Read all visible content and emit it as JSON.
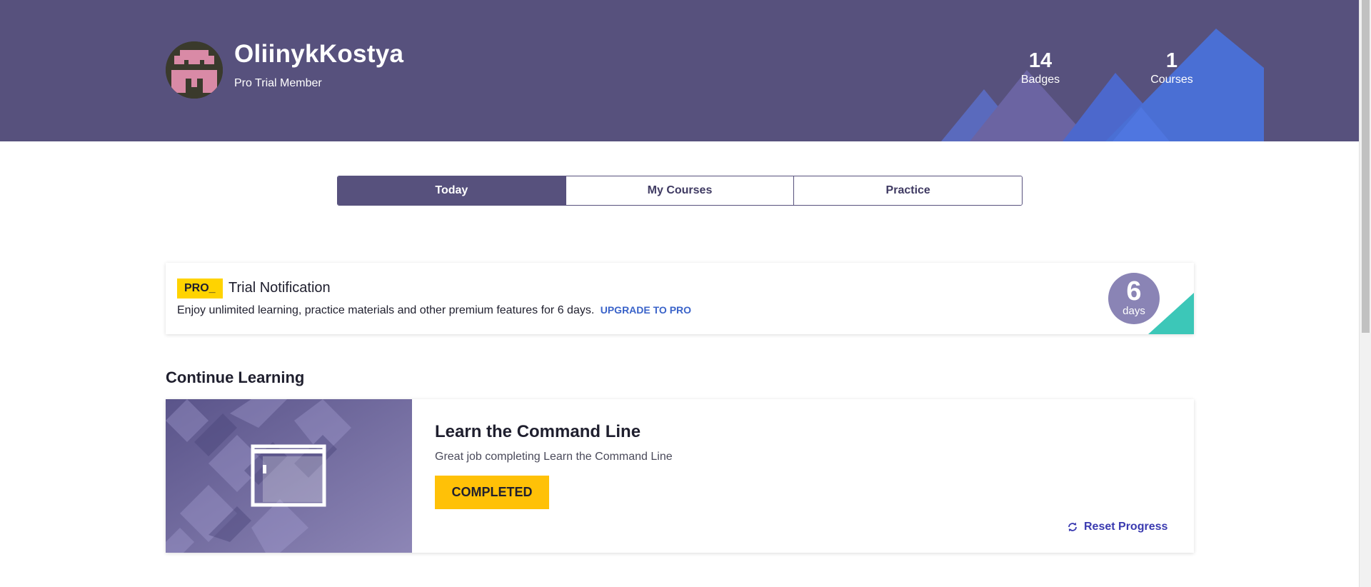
{
  "profile": {
    "username": "OliinykKostya",
    "membership": "Pro Trial Member",
    "avatar_icon": "pixel-avatar-icon"
  },
  "stats": [
    {
      "value": "14",
      "label": "Badges"
    },
    {
      "value": "1",
      "label": "Courses"
    }
  ],
  "tabs": [
    {
      "label": "Today",
      "active": true
    },
    {
      "label": "My Courses",
      "active": false
    },
    {
      "label": "Practice",
      "active": false
    }
  ],
  "trial": {
    "badge": "PRO_",
    "title": "Trial Notification",
    "text": "Enjoy unlimited learning, practice materials and other premium features for 6 days.",
    "link": "UPGRADE TO PRO",
    "days_value": "6",
    "days_label": "days"
  },
  "continue_learning": {
    "heading": "Continue Learning",
    "course_title": "Learn the Command Line",
    "course_description": "Great job completing Learn the Command Line",
    "status_button": "COMPLETED",
    "reset_label": "Reset Progress",
    "reset_icon": "refresh-icon"
  },
  "colors": {
    "header_bg": "#57517d",
    "accent_blue": "#4a6fd4",
    "pro_yellow": "#ffd300",
    "completed_yellow": "#ffc107",
    "teal": "#3cc7b8",
    "days_circle": "#8a84b5"
  }
}
